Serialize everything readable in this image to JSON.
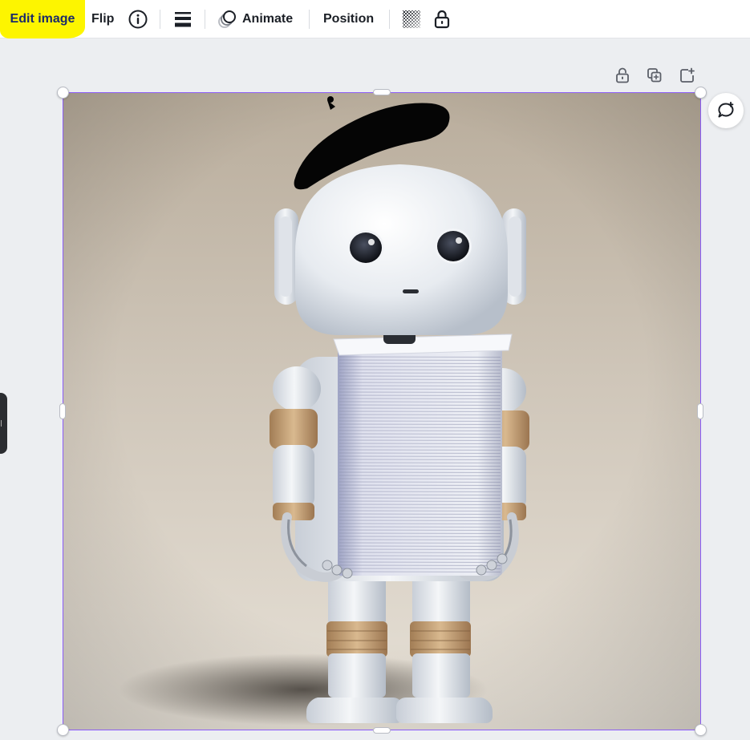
{
  "toolbar": {
    "edit_image_label": "Edit image",
    "flip_label": "Flip",
    "info_icon": "info-icon",
    "lines_icon": "border-style-icon",
    "animate_label": "Animate",
    "animate_icon": "animate-icon",
    "position_label": "Position",
    "transparency_icon": "transparency-icon",
    "lock_icon": "unlock-icon",
    "highlight_color": "#fdf500"
  },
  "canvas_actions": {
    "lock_icon": "unlock-icon",
    "duplicate_icon": "duplicate-icon",
    "add_page_icon": "add-page-icon",
    "comment_icon": "add-comment-icon"
  },
  "image": {
    "subject": "robot-with-beret-holding-paper-stack",
    "selection_color": "#8b5cf6"
  }
}
